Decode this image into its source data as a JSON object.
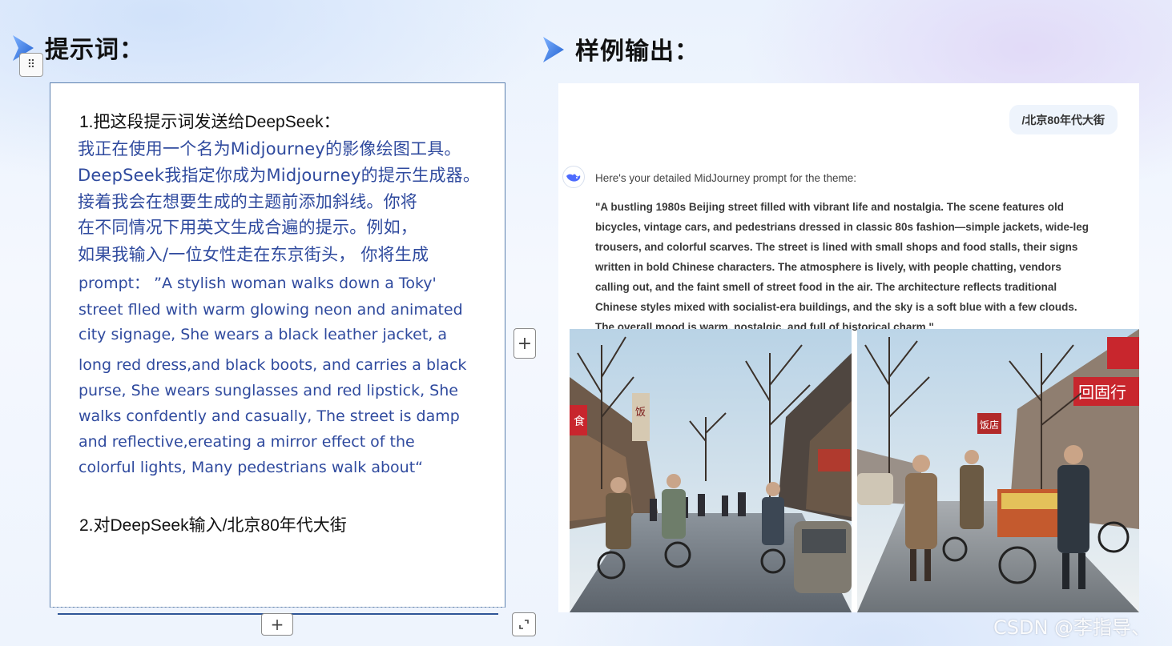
{
  "left_section": {
    "title": "提示词：",
    "step1": "1.把这段提示词发送给DeepSeek：",
    "cn_lines": [
      "我正在使用一个名为Midjourney的影像绘图工具。",
      "DeepSeek我指定你成为Midjourney的提示生成器。",
      "接着我会在想要生成的主题前添加斜线。你将",
      "在不同情况下用英文生成合遍的提示。例如，",
      "如果我输入/一位女性走在东京街头，  你将生成"
    ],
    "en_lines": [
      "prompt：  ”A stylish woman walks down a Toky'",
      "street flled with warm glowing  neon and animated",
      "city signage, She wears a black leather jacket, a",
      "long red dress,and black boots, and carries a black",
      "purse, She wears sunglasses and red lipstick, She",
      "walks confdently and casually, The street is damp",
      "and reflective,ereating a mirror effect of the",
      "colorful lights,  Many pedestrians walk about“"
    ],
    "step2": "2.对DeepSeek输入/北京80年代大街"
  },
  "right_section": {
    "title": "样例输出：",
    "user_message": "/北京80年代大街",
    "reply_intro": "Here's your detailed MidJourney prompt for the theme:",
    "reply_lines": [
      "\"A bustling 1980s Beijing street filled with vibrant life and nostalgia. The scene features old",
      "bicycles, vintage cars, and pedestrians dressed in classic 80s fashion—simple jackets, wide-leg",
      "trousers, and colorful scarves. The street is lined with small shops and food stalls, their signs",
      "written in bold Chinese characters. The atmosphere is lively, with people chatting, vendors",
      "calling out, and the faint smell of street food in the air. The architecture reflects traditional",
      "Chinese styles mixed with socialist-era buildings, and the sky is a soft blue with a few clouds.",
      "The overall mood is warm, nostalgic, and full of historical charm.\""
    ],
    "photo_left_signs": [
      "食",
      "饭"
    ],
    "photo_right_signs": [
      "回",
      "固",
      "行",
      "饭",
      "店"
    ]
  },
  "buttons": {
    "plus": "+",
    "drag": "⠿"
  },
  "watermark": "CSDN @李指导、",
  "colors": {
    "prompt_text": "#2f4a9e",
    "title_text": "#111111",
    "pointer_blue": "#2b6fd8",
    "box_border": "#5b7fae",
    "shop_red": "#c8262d"
  },
  "icons": {
    "pointer": "pointer-arrow-icon",
    "drag": "drag-handle-icon",
    "plus": "plus-icon",
    "resize": "resize-corner-icon",
    "assistant": "deepseek-whale-icon"
  }
}
